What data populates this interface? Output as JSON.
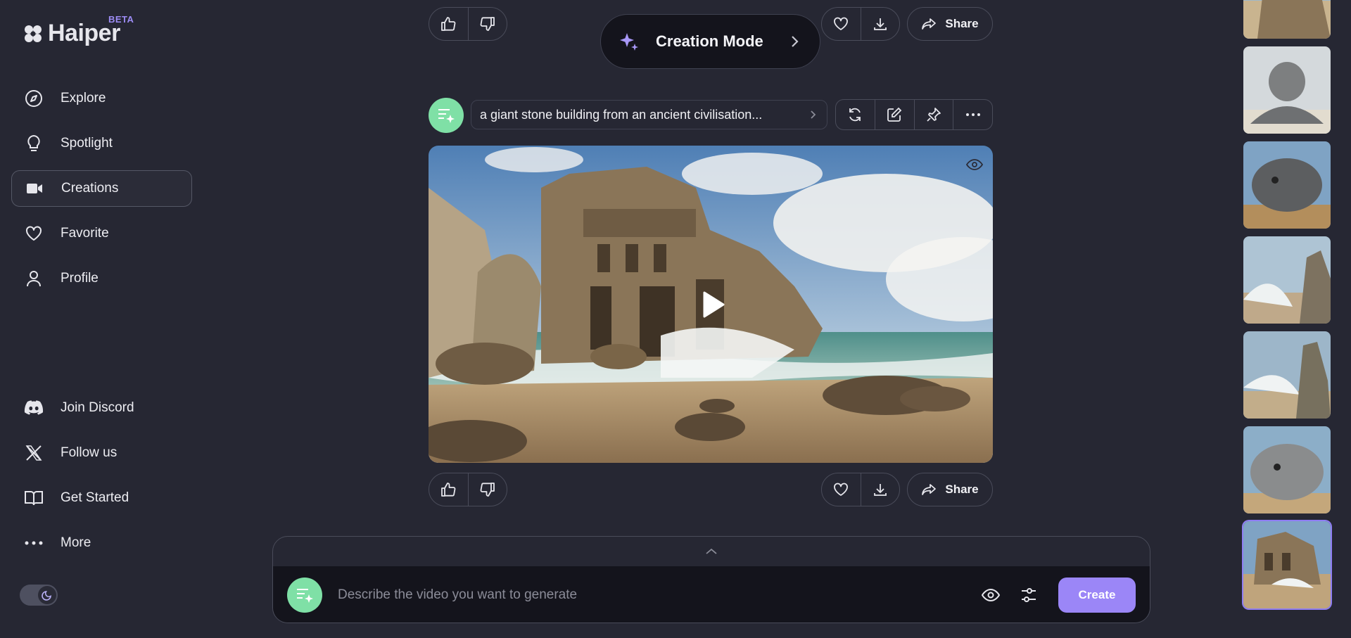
{
  "brand": {
    "name": "Haiper",
    "badge": "BETA"
  },
  "nav": {
    "primary": [
      {
        "label": "Explore",
        "icon": "compass-icon"
      },
      {
        "label": "Spotlight",
        "icon": "lightbulb-icon"
      },
      {
        "label": "Creations",
        "icon": "video-camera-icon",
        "active": true
      },
      {
        "label": "Favorite",
        "icon": "heart-icon"
      },
      {
        "label": "Profile",
        "icon": "user-icon"
      }
    ],
    "secondary": [
      {
        "label": "Join Discord",
        "icon": "discord-icon"
      },
      {
        "label": "Follow us",
        "icon": "x-logo-icon"
      },
      {
        "label": "Get Started",
        "icon": "book-icon"
      },
      {
        "label": "More",
        "icon": "more-dots-icon"
      }
    ]
  },
  "header": {
    "creation_mode_label": "Creation Mode"
  },
  "actions": {
    "share_label": "Share"
  },
  "creation": {
    "prompt": "a giant stone building from an ancient civilisation..."
  },
  "composer": {
    "placeholder": "Describe the video you want to generate",
    "create_label": "Create"
  },
  "colors": {
    "background": "#262733",
    "accent": "#9b86f7",
    "avatar": "#7fe0a6",
    "panel": "#14141c"
  }
}
